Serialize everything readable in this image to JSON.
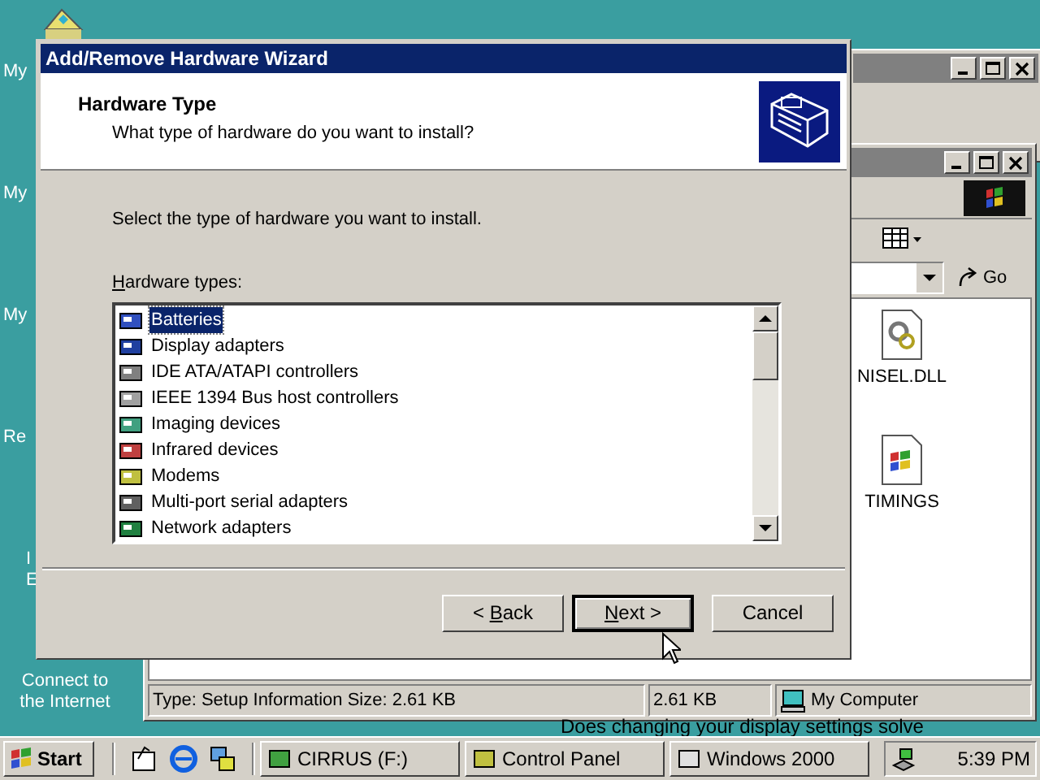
{
  "desktop_icons": [
    {
      "lines": [
        "My"
      ]
    },
    {
      "lines": [
        "My"
      ]
    },
    {
      "lines": [
        "My"
      ]
    },
    {
      "lines": [
        "Re"
      ]
    },
    {
      "lines": [
        "I",
        "E"
      ]
    },
    {
      "lines": [
        "Connect to",
        "the Internet"
      ]
    }
  ],
  "explorer": {
    "go_label": "Go",
    "files": [
      {
        "name": "NISEL.DLL",
        "kind": "dll"
      },
      {
        "name": "TIMINGS",
        "kind": "setup"
      }
    ],
    "status_bar": [
      "Type: Setup Information Size: 2.61 KB",
      "2.61 KB",
      "My Computer"
    ],
    "behind_text": "Does changing your display settings solve"
  },
  "wizard": {
    "title": "Add/Remove Hardware Wizard",
    "header_title": "Hardware Type",
    "header_subtitle": "What type of hardware do you want to install?",
    "instruction": "Select the type of hardware you want to install.",
    "list_label": {
      "key": "H",
      "after": "ardware types:"
    },
    "items": [
      {
        "name": "Batteries",
        "selected": true
      },
      {
        "name": "Display adapters",
        "selected": false
      },
      {
        "name": "IDE ATA/ATAPI controllers",
        "selected": false
      },
      {
        "name": "IEEE 1394 Bus host controllers",
        "selected": false
      },
      {
        "name": "Imaging devices",
        "selected": false
      },
      {
        "name": "Infrared devices",
        "selected": false
      },
      {
        "name": "Modems",
        "selected": false
      },
      {
        "name": "Multi-port serial adapters",
        "selected": false
      },
      {
        "name": "Network adapters",
        "selected": false
      }
    ],
    "buttons": [
      {
        "label": {
          "before": "< ",
          "key": "B",
          "after": "ack"
        },
        "default": false
      },
      {
        "label": {
          "key": "N",
          "after": "ext >"
        },
        "default": true
      },
      {
        "label": {
          "before": "Cancel"
        },
        "default": false
      }
    ]
  },
  "taskbar": {
    "start": "Start",
    "tasks": [
      {
        "label": "CIRRUS (F:)"
      },
      {
        "label": "Control Panel"
      },
      {
        "label": "Windows 2000"
      }
    ],
    "clock": "5:39 PM"
  }
}
